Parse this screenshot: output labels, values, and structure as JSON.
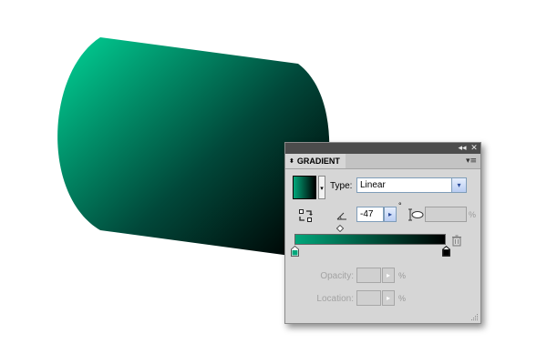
{
  "canvas": {
    "shape_gradient_start": "#01c48c",
    "shape_gradient_end": "#000000"
  },
  "panel": {
    "titlebar": {
      "collapse_glyph": "◂◂",
      "close_glyph": "✕"
    },
    "tab": {
      "label": "GRADIENT",
      "arrows_glyph": "⬍"
    },
    "menu_glyph": "▾≡",
    "type": {
      "label": "Type:",
      "value": "Linear",
      "dropdown_glyph": "▾"
    },
    "swatch_drop_glyph": "▾",
    "angle": {
      "value": "-47",
      "unit": "°",
      "button_glyph": "▸"
    },
    "aspect": {
      "value": "",
      "unit": "%"
    },
    "ramp": {
      "start_color": "#01a77b",
      "end_color": "#000000"
    },
    "opacity": {
      "label": "Opacity:",
      "value": "",
      "unit": "%",
      "button_glyph": "▸"
    },
    "location": {
      "label": "Location:",
      "value": "",
      "unit": "%",
      "button_glyph": "▸"
    }
  }
}
